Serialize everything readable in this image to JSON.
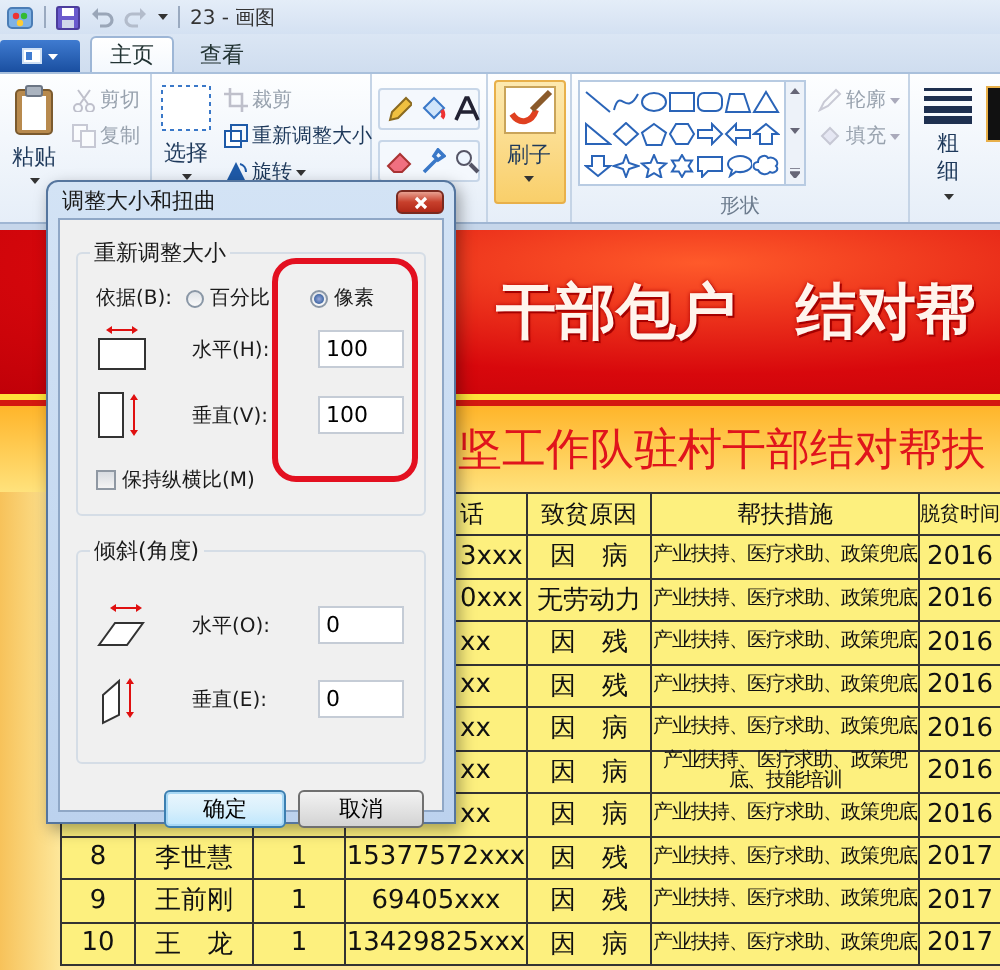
{
  "window": {
    "title": "23 - 画图"
  },
  "tabs": [
    {
      "label": "主页",
      "selected": true
    },
    {
      "label": "查看",
      "selected": false
    }
  ],
  "ribbon": {
    "clipboard": {
      "paste": "粘贴",
      "items": [
        {
          "label": "剪切",
          "disabled": true
        },
        {
          "label": "复制",
          "disabled": true
        }
      ]
    },
    "image": {
      "select": "选择",
      "items": [
        {
          "label": "裁剪",
          "disabled": true
        },
        {
          "label": "重新调整大小",
          "disabled": false
        },
        {
          "label": "旋转",
          "disabled": false
        }
      ]
    },
    "brush": {
      "label": "刷子",
      "selected": true
    },
    "shapes": {
      "label": "形状",
      "items": [
        {
          "label": "轮廓",
          "disabled": true
        },
        {
          "label": "填充",
          "disabled": true
        }
      ]
    },
    "size": {
      "label": "粗细"
    }
  },
  "canvas": {
    "title": "干部包户　结对帮",
    "subtitle": "坚工作队驻村干部结对帮扶",
    "header": {
      "phone": "话",
      "cause": "致贫原因",
      "measures": "帮扶措施",
      "year": "脱贫时间"
    },
    "rows": [
      {
        "phone": "3xxx",
        "cause": "因　病",
        "measures": "产业扶持、医疗求助、政策兜底",
        "year": "2016"
      },
      {
        "phone": "0xxx",
        "cause": "无劳动力",
        "measures": "产业扶持、医疗求助、政策兜底",
        "year": "2016"
      },
      {
        "phone": "xx",
        "cause": "因　残",
        "measures": "产业扶持、医疗求助、政策兜底",
        "year": "2016"
      },
      {
        "phone": "xx",
        "cause": "因　残",
        "measures": "产业扶持、医疗求助、政策兜底",
        "year": "2016"
      },
      {
        "phone": "xx",
        "cause": "因　病",
        "measures": "产业扶持、医疗求助、政策兜底",
        "year": "2016"
      },
      {
        "phone": "xx",
        "cause": "因　病",
        "measures": "产业扶持、医疗求助、政策兜底、技能培训",
        "year": "2016"
      },
      {
        "phone": "xx",
        "cause": "因　病",
        "measures": "产业扶持、医疗求助、政策兜底",
        "year": "2016"
      },
      {
        "number": "8",
        "name": "李世慧",
        "people": "1",
        "phone": "15377572xxx",
        "cause": "因　残",
        "measures": "产业扶持、医疗求助、政策兜底",
        "year": "2017"
      },
      {
        "number": "9",
        "name": "王前刚",
        "people": "1",
        "phone": "69405xxx",
        "cause": "因　残",
        "measures": "产业扶持、医疗求助、政策兜底",
        "year": "2017"
      },
      {
        "number": "10",
        "name": "王　龙",
        "people": "1",
        "phone": "13429825xxx",
        "cause": "因　病",
        "measures": "产业扶持、医疗求助、政策兜底",
        "year": "2017"
      }
    ]
  },
  "dialog": {
    "title": "调整大小和扭曲",
    "resize": {
      "legend": "重新调整大小",
      "by_label": "依据(B):",
      "options": [
        {
          "label": "百分比",
          "selected": false
        },
        {
          "label": "像素",
          "selected": true
        }
      ],
      "horizontal": {
        "label": "水平(H):",
        "value": "100"
      },
      "vertical": {
        "label": "垂直(V):",
        "value": "100"
      },
      "keep_ratio": {
        "label": "保持纵横比(M)",
        "checked": false
      }
    },
    "skew": {
      "legend": "倾斜(角度)",
      "horizontal": {
        "label": "水平(O):",
        "value": "0"
      },
      "vertical": {
        "label": "垂直(E):",
        "value": "0"
      }
    },
    "buttons": [
      {
        "label": "确定",
        "default": true
      },
      {
        "label": "取消",
        "default": false
      }
    ]
  }
}
